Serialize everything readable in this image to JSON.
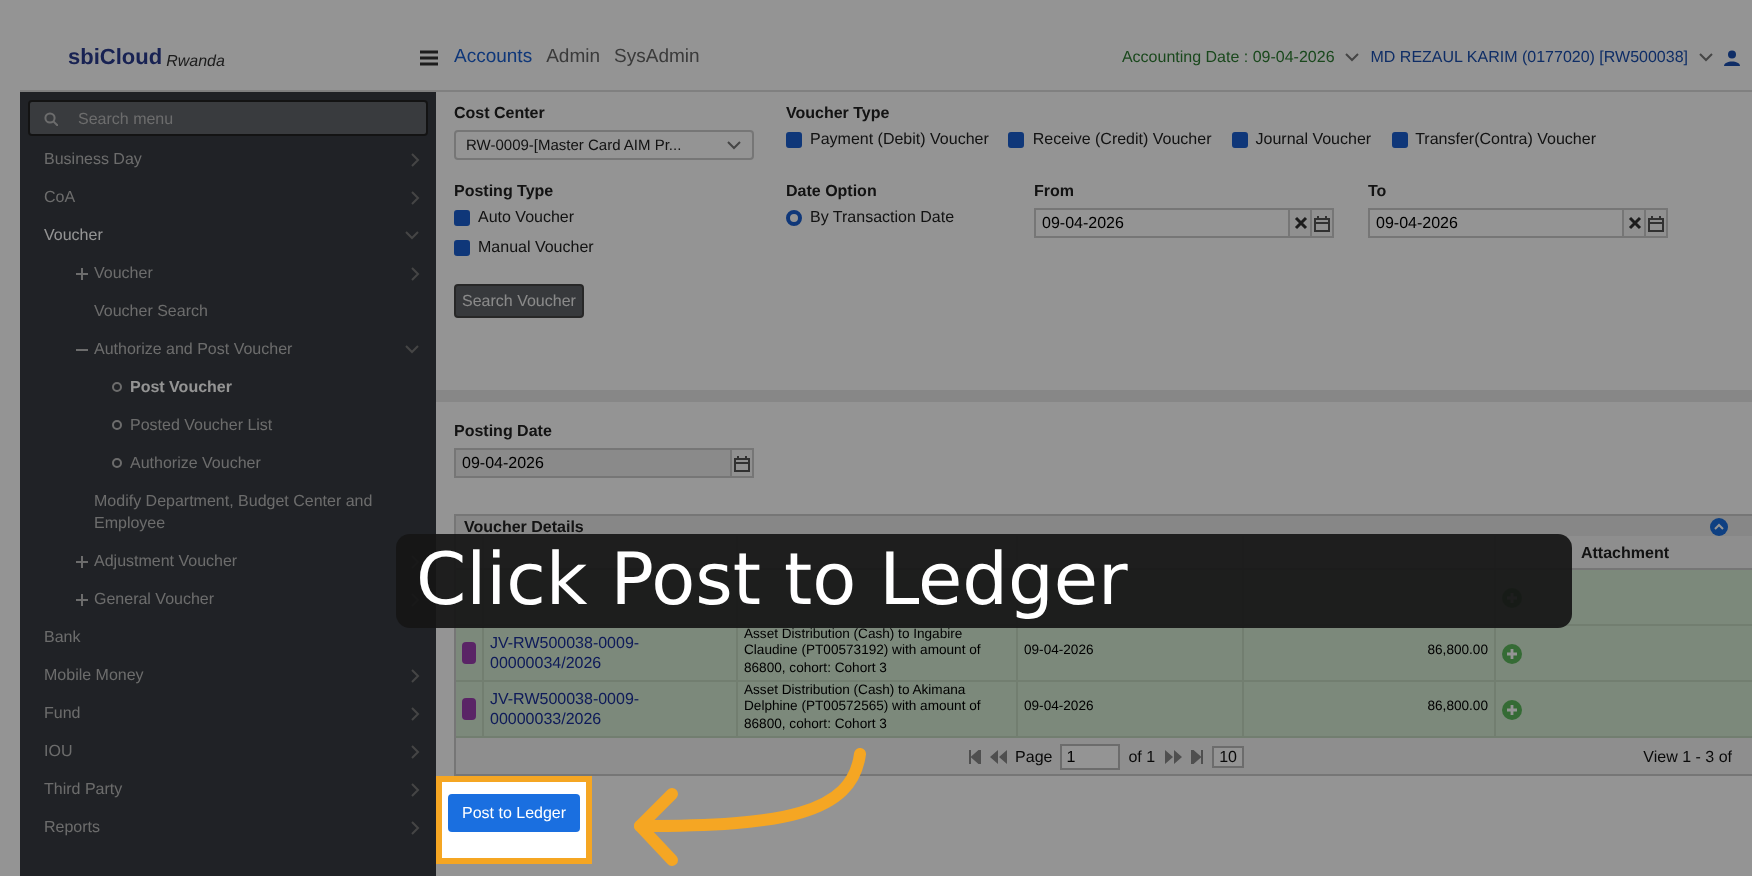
{
  "header": {
    "logo": {
      "name": "sbiCloud",
      "region": "Rwanda"
    },
    "nav": [
      {
        "label": "Accounts",
        "selected": true
      },
      {
        "label": "Admin",
        "selected": false
      },
      {
        "label": "SysAdmin",
        "selected": false
      }
    ],
    "accounting_date": "Accounting Date : 09-04-2026",
    "user": "MD REZAUL KARIM (0177020) [RW500038]"
  },
  "sidebar": {
    "search": {
      "placeholder": "Search menu"
    },
    "items": [
      {
        "label": "Business Day",
        "kind": "menu",
        "expanded": false,
        "selected": false
      },
      {
        "label": "CoA",
        "kind": "menu",
        "expanded": false,
        "selected": false
      },
      {
        "label": "Voucher",
        "kind": "menu",
        "expanded": true,
        "selected": false,
        "children": [
          {
            "label": "Voucher",
            "kind": "group",
            "expanded": false,
            "selected": false
          },
          {
            "label": "Voucher Search",
            "kind": "link",
            "selected": false
          },
          {
            "label": "Authorize and Post Voucher",
            "kind": "group",
            "expanded": true,
            "selected": false,
            "children": [
              {
                "label": "Post Voucher",
                "kind": "leaf",
                "selected": true
              },
              {
                "label": "Posted Voucher List",
                "kind": "leaf",
                "selected": false
              },
              {
                "label": "Authorize Voucher",
                "kind": "leaf",
                "selected": false
              }
            ]
          },
          {
            "label": "Modify Department, Budget Center and Employee",
            "kind": "link",
            "selected": false
          },
          {
            "label": "Adjustment Voucher",
            "kind": "group",
            "expanded": false,
            "selected": false
          },
          {
            "label": "General Voucher",
            "kind": "group",
            "expanded": false,
            "selected": false
          }
        ]
      },
      {
        "label": "Bank",
        "kind": "link",
        "selected": false
      },
      {
        "label": "Mobile Money",
        "kind": "menu",
        "expanded": false,
        "selected": false
      },
      {
        "label": "Fund",
        "kind": "menu",
        "expanded": false,
        "selected": false
      },
      {
        "label": "IOU",
        "kind": "menu",
        "expanded": false,
        "selected": false
      },
      {
        "label": "Third Party",
        "kind": "menu",
        "expanded": false,
        "selected": false
      },
      {
        "label": "Reports",
        "kind": "menu",
        "expanded": false,
        "selected": false
      }
    ]
  },
  "filters": {
    "cost_center": {
      "label": "Cost Center",
      "value": "RW-0009-[Master Card AIM Pr..."
    },
    "voucher_type": {
      "label": "Voucher Type",
      "options": [
        {
          "label": "Payment (Debit) Voucher",
          "checked": true
        },
        {
          "label": "Receive (Credit) Voucher",
          "checked": true
        },
        {
          "label": "Journal Voucher",
          "checked": true
        },
        {
          "label": "Transfer(Contra) Voucher",
          "checked": true
        }
      ]
    },
    "posting_type": {
      "label": "Posting Type",
      "options": [
        {
          "label": "Auto Voucher",
          "checked": true
        },
        {
          "label": "Manual Voucher",
          "checked": true
        }
      ]
    },
    "date_option": {
      "label": "Date Option",
      "options": [
        {
          "label": "By Transaction Date",
          "selected": true
        }
      ]
    },
    "from": {
      "label": "From",
      "value": "09-04-2026"
    },
    "to": {
      "label": "To",
      "value": "09-04-2026"
    },
    "search_button": "Search Voucher"
  },
  "posting": {
    "date": {
      "label": "Posting Date",
      "value": "09-04-2026"
    },
    "voucher_details": {
      "title": "Voucher Details",
      "columns": [
        {},
        {},
        {},
        {},
        {},
        {
          "label": "Attachment"
        }
      ],
      "rows": [
        {},
        {
          "checked": true,
          "voucher_no": "JV-RW500038-0009-00000034/2026",
          "particulars": "Asset Distribution (Cash) to Ingabire Claudine (PT00573192) with amount of 86800, cohort: Cohort 3",
          "date": "09-04-2026",
          "amount": "86,800.00"
        },
        {
          "checked": true,
          "voucher_no": "JV-RW500038-0009-00000033/2026",
          "particulars": "Asset Distribution (Cash) to Akimana Delphine (PT00572565) with amount of 86800, cohort: Cohort 3",
          "date": "09-04-2026",
          "amount": "86,800.00"
        }
      ],
      "pager": {
        "page_label": "Page",
        "page": "1",
        "of": "of 1",
        "page_size": "10",
        "summary": "View 1 - 3 of"
      }
    },
    "post_button": "Post to Ledger"
  },
  "tooltip": {
    "text": "Click Post to Ledger"
  }
}
